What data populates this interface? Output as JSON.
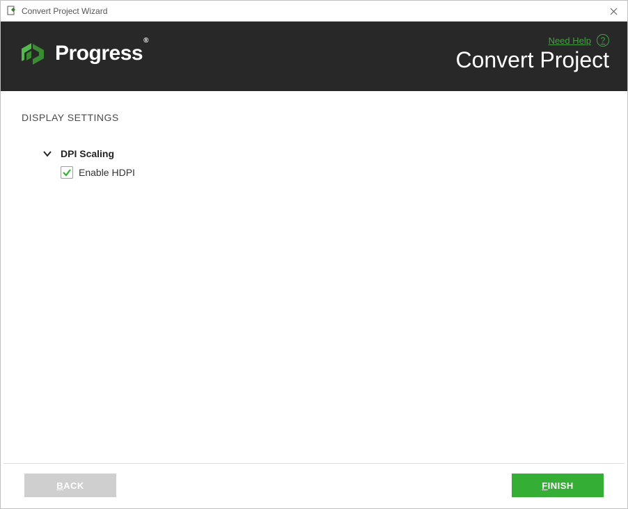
{
  "window": {
    "title": "Convert Project Wizard"
  },
  "header": {
    "brand": "Progress",
    "title": "Convert Project",
    "help_label": "Need Help"
  },
  "content": {
    "section_heading": "DISPLAY SETTINGS",
    "group": {
      "title": "DPI Scaling",
      "checkbox_label": "Enable HDPI",
      "checkbox_checked": true
    }
  },
  "footer": {
    "back_label": "BACK",
    "finish_label": "FINISH"
  }
}
